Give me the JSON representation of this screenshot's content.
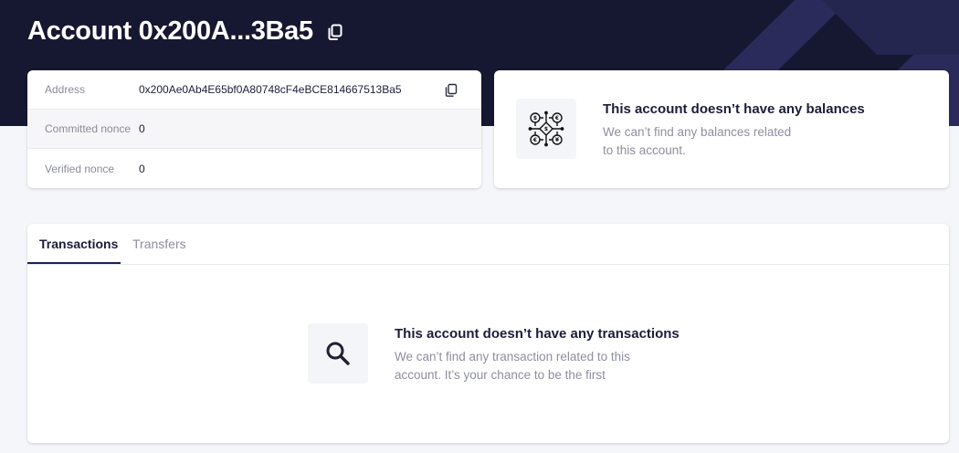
{
  "header": {
    "title": "Account 0x200A...3Ba5",
    "copy_icon": "copy-icon"
  },
  "account_info": {
    "rows": [
      {
        "label": "Address",
        "value": "0x200Ae0Ab4E65bf0A80748cF4eBCE814667513Ba5",
        "icon": "copy-icon"
      },
      {
        "label": "Committed nonce",
        "value": "0"
      },
      {
        "label": "Verified nonce",
        "value": "0"
      }
    ]
  },
  "balances": {
    "icon": "currency-network-icon",
    "title": "This account doesn’t have any balances",
    "text_line1": "We can’t find any balances related",
    "text_line2": "to this account."
  },
  "tabs": [
    {
      "label": "Transactions",
      "active": true
    },
    {
      "label": "Transfers",
      "active": false
    }
  ],
  "transactions": {
    "icon": "search-icon",
    "title": "This account doesn’t have any transactions",
    "text_line1": "We can’t find any transaction related to this",
    "text_line2": "account. It’s your chance to be the first"
  },
  "colors": {
    "header_bg": "#161731",
    "decor_shape": "#2a2b5a",
    "active_tab_underline": "#1e2156"
  }
}
